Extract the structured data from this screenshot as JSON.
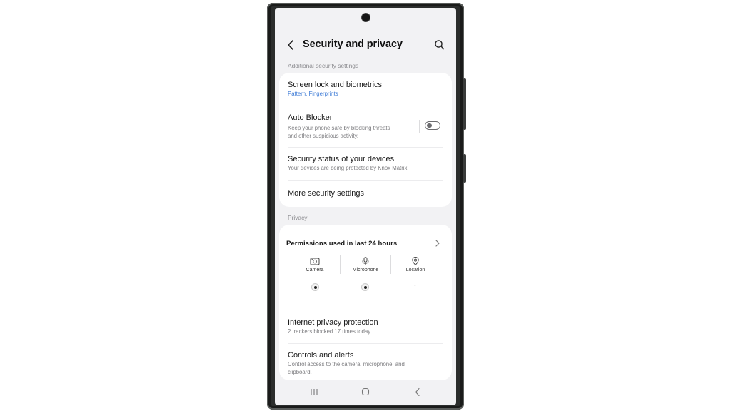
{
  "app_bar": {
    "title": "Security and privacy",
    "back_icon": "chevron-left-icon",
    "search_icon": "search-icon"
  },
  "additional_security": {
    "section_label": "Additional security settings",
    "items": [
      {
        "title": "Screen lock and biometrics",
        "subtitle": "Pattern, Fingerprints"
      },
      {
        "title": "Auto Blocker",
        "subtitle_line1": "Keep your phone safe by blocking threats",
        "subtitle_line2": "and other suspicious activity.",
        "toggle_on": false
      },
      {
        "title": "Security status of your devices",
        "subtitle": "Your devices are being protected by Knox Matrix."
      },
      {
        "title": "More security settings"
      }
    ]
  },
  "privacy": {
    "section_label": "Privacy",
    "permissions_title": "Permissions used in last 24 hours",
    "permissions": [
      {
        "label": "Camera",
        "icon": "camera-icon",
        "used": true
      },
      {
        "label": "Microphone",
        "icon": "microphone-icon",
        "used": true
      },
      {
        "label": "Location",
        "icon": "location-pin-icon",
        "used": false,
        "value": "-"
      }
    ],
    "items": [
      {
        "title": "Internet privacy protection",
        "subtitle": "2 trackers blocked 17 times today"
      },
      {
        "title": "Controls and alerts",
        "subtitle_line1": "Control access to the camera, microphone, and",
        "subtitle_line2": "clipboard."
      }
    ]
  },
  "nav_bar": {
    "buttons": [
      "recent-apps-icon",
      "home-icon",
      "back-icon"
    ]
  },
  "colors": {
    "screen_background": "#f2f2f4",
    "card_background": "#ffffff",
    "link_blue": "#3e7bd6",
    "phone_frame": "#2b2d2c"
  }
}
